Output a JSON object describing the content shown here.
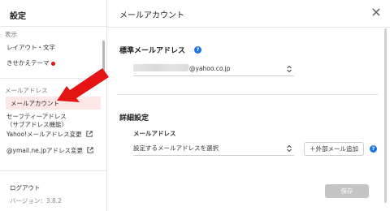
{
  "sidebar": {
    "title": "設定",
    "section_display": "表示",
    "layout_label": "レイアウト・文字",
    "theme_label": "きせかえテーマ",
    "section_mail": "メールアドレス",
    "mail_account_label": "メールアカウント",
    "safety_address_line1": "セーフティーアドレス",
    "safety_address_line2": "（サブアドレス機能）",
    "yahoo_change_label": "Yahoo!メールアドレス変更",
    "ymail_change_label": "@ymail.ne.jpアドレス変更",
    "logout_label": "ログアウト",
    "version_label": "バージョン：3.8.2"
  },
  "header": {
    "title": "メールアカウント"
  },
  "main": {
    "standard_title": "標準メールアドレス",
    "standard_select_value": "@yahoo.co.jp",
    "details_title": "詳細設定",
    "mail_address_label": "メールアドレス",
    "mail_select_value": "設定するメールアドレスを選択",
    "add_external_label": "＋外部メール追加",
    "save_label": "保存",
    "help_glyph": "?"
  },
  "colors": {
    "accent": "#e41414",
    "active_bg": "#fde6e6",
    "help": "#1a73e8"
  }
}
